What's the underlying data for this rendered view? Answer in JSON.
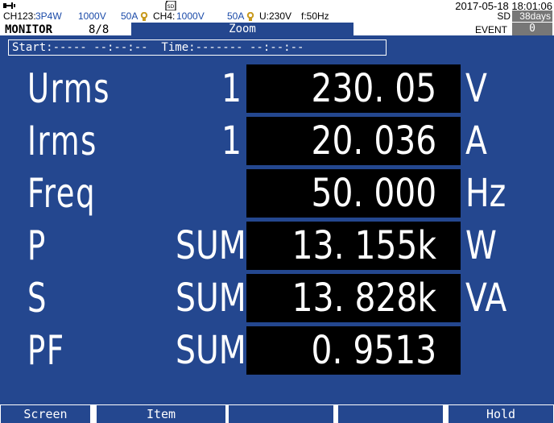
{
  "header": {
    "datetime": "2017-05-18 18:01:06",
    "ch123_label": "CH123:",
    "wiring": "3P4W",
    "voltage_range_1": "1000V",
    "current_range_1": "50A",
    "ch4_label": "CH4:",
    "ch4_voltage_range": "1000V",
    "current_range_2": "50A",
    "nominal_voltage": "U:230V",
    "frequency": "f:50Hz",
    "sd_label": "SD",
    "sd_days": "38days",
    "monitor_label": "MONITOR",
    "page": "8/8",
    "view_tab": "Zoom",
    "event_label": "EVENT",
    "event_count": "0",
    "clamp_icon": "clamp-sensor-icon",
    "network_icon": "network-icon",
    "sd_icon": "sd-card-icon"
  },
  "record": {
    "text": "Start:----- --:--:--  Time:------- --:--:--"
  },
  "measurements": [
    {
      "name": "Urms",
      "channel": "1",
      "value": "230. 05",
      "unit": "V"
    },
    {
      "name": "Irms",
      "channel": "1",
      "value": "20. 036",
      "unit": "A"
    },
    {
      "name": "Freq",
      "channel": "",
      "value": "50. 000",
      "unit": "Hz"
    },
    {
      "name": "P",
      "channel": "SUM",
      "value": "13. 155k",
      "unit": "W"
    },
    {
      "name": "S",
      "channel": "SUM",
      "value": "13. 828k",
      "unit": "VA"
    },
    {
      "name": "PF",
      "channel": "SUM",
      "value": "0. 9513",
      "unit": ""
    }
  ],
  "softkeys": [
    "Screen",
    "Item",
    "",
    "",
    "",
    "Hold"
  ],
  "colors": {
    "background": "#24478f",
    "value_box": "#000000",
    "header_bg": "#ffffff",
    "accent_blue": "#1a4aa8",
    "accent_gold": "#c89a1e"
  }
}
